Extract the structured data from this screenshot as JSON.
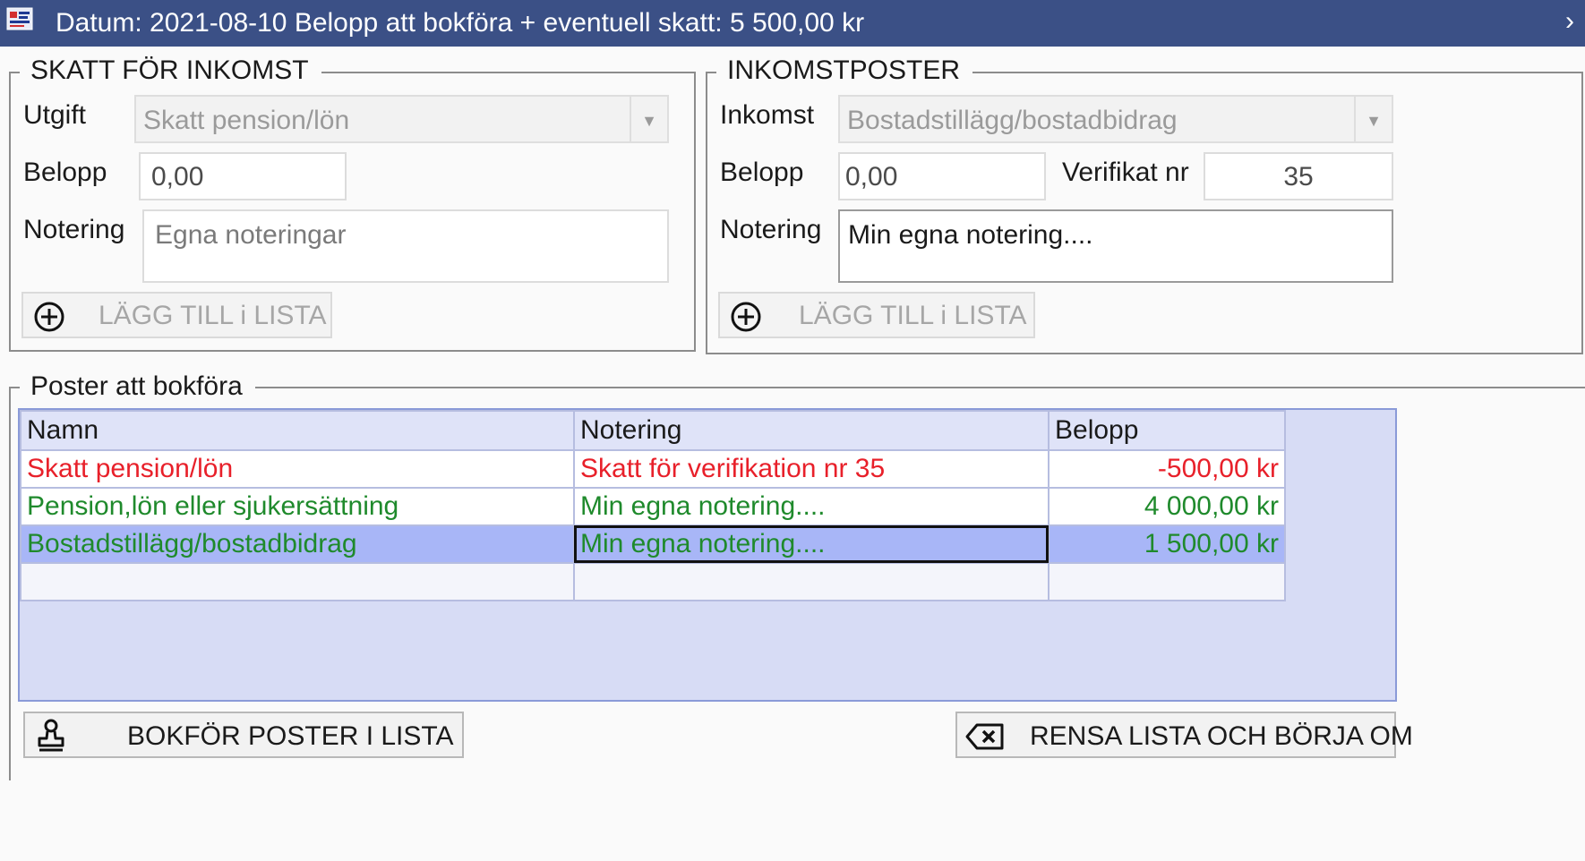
{
  "window": {
    "title": "Datum: 2021-08-10 Belopp att bokföra + eventuell skatt: 5 500,00 kr",
    "chevron": "›"
  },
  "tax_group": {
    "legend": "SKATT FÖR INKOMST",
    "utgift_label": "Utgift",
    "utgift_value": "Skatt pension/lön",
    "belopp_label": "Belopp",
    "belopp_value": "0,00",
    "notering_label": "Notering",
    "notering_placeholder": "Egna noteringar",
    "add_button_label": "LÄGG TILL i LISTA"
  },
  "income_group": {
    "legend": "INKOMSTPOSTER",
    "inkomst_label": "Inkomst",
    "inkomst_value": "Bostadstillägg/bostadbidrag",
    "belopp_label": "Belopp",
    "belopp_value": "0,00",
    "verifikat_label": "Verifikat nr",
    "verifikat_value": "35",
    "notering_label": "Notering",
    "notering_value": "Min egna notering....",
    "add_button_label": "LÄGG TILL i LISTA"
  },
  "posts_group": {
    "legend": "Poster att bokföra",
    "columns": [
      "Namn",
      "Notering",
      "Belopp"
    ],
    "rows": [
      {
        "namn": "Skatt pension/lön",
        "notering": "Skatt för verifikation nr 35",
        "belopp": "-500,00 kr",
        "color": "#e8202a"
      },
      {
        "namn": "Pension,lön eller sjukersättning",
        "notering": "Min egna notering....",
        "belopp": "4 000,00 kr",
        "color": "#1f8a2c"
      },
      {
        "namn": "Bostadstillägg/bostadbidrag",
        "notering": "Min egna notering....",
        "belopp": "1 500,00 kr",
        "color": "#1f8a2c",
        "selected": true
      }
    ]
  },
  "actions": {
    "book_label": "BOKFÖR POSTER I LISTA",
    "clear_label": "RENSA LISTA OCH BÖRJA OM"
  },
  "icons": {
    "app": "app-icon",
    "add": "plus-circle-icon",
    "book": "stamp-icon",
    "clear": "backspace-icon"
  },
  "colors": {
    "titlebar": "#3b5086",
    "negative_row": "#e8202a",
    "positive_row": "#1f8a2c",
    "selected_row": "#a8b6f7",
    "grid_background": "#d7dcf5"
  }
}
